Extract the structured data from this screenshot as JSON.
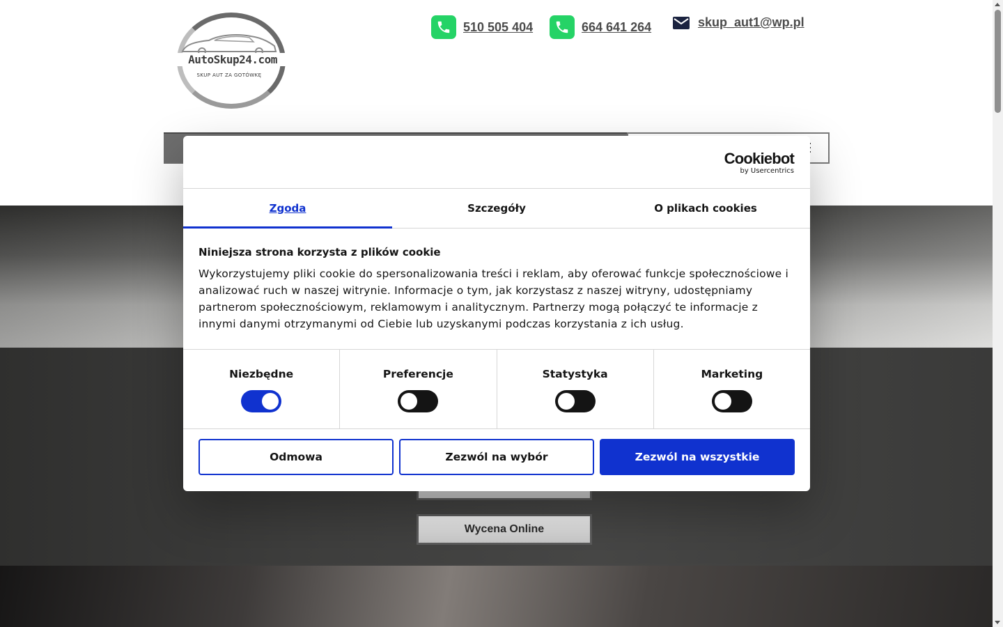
{
  "header": {
    "logo": {
      "brand": "AutoSkup24.com",
      "tagline": "SKUP AUT ZA GOTÓWKĘ"
    },
    "phone1": "510 505 404",
    "phone2": "664 641 264",
    "email": "skup_aut1@wp.pl",
    "phone_icon_color": "#25d366"
  },
  "hero": {
    "buttons": [
      "Wycena Online"
    ]
  },
  "cookie_dialog": {
    "brand": "Cookiebot",
    "brand_sub": "by Usercentrics",
    "tabs": [
      {
        "label": "Zgoda",
        "active": true
      },
      {
        "label": "Szczegóły",
        "active": false
      },
      {
        "label": "O plikach cookies",
        "active": false
      }
    ],
    "title": "Niniejsza strona korzysta z plików cookie",
    "text": "Wykorzystujemy pliki cookie do spersonalizowania treści i reklam, aby oferować funkcje społecznościowe i analizować ruch w naszej witrynie. Informacje o tym, jak korzystasz z naszej witryny, udostępniamy partnerom społecznościowym, reklamowym i analitycznym. Partnerzy mogą połączyć te informacje z innymi danymi otrzymanymi od Ciebie lub uzyskanymi podczas korzystania z ich usług.",
    "toggles": [
      {
        "label": "Niezbędne",
        "on": true
      },
      {
        "label": "Preferencje",
        "on": false
      },
      {
        "label": "Statystyka",
        "on": false
      },
      {
        "label": "Marketing",
        "on": false
      }
    ],
    "buttons": {
      "deny": "Odmowa",
      "allow_selection": "Zezwól na wybór",
      "allow_all": "Zezwól na wszystkie"
    },
    "accent_color": "#1032cf"
  }
}
